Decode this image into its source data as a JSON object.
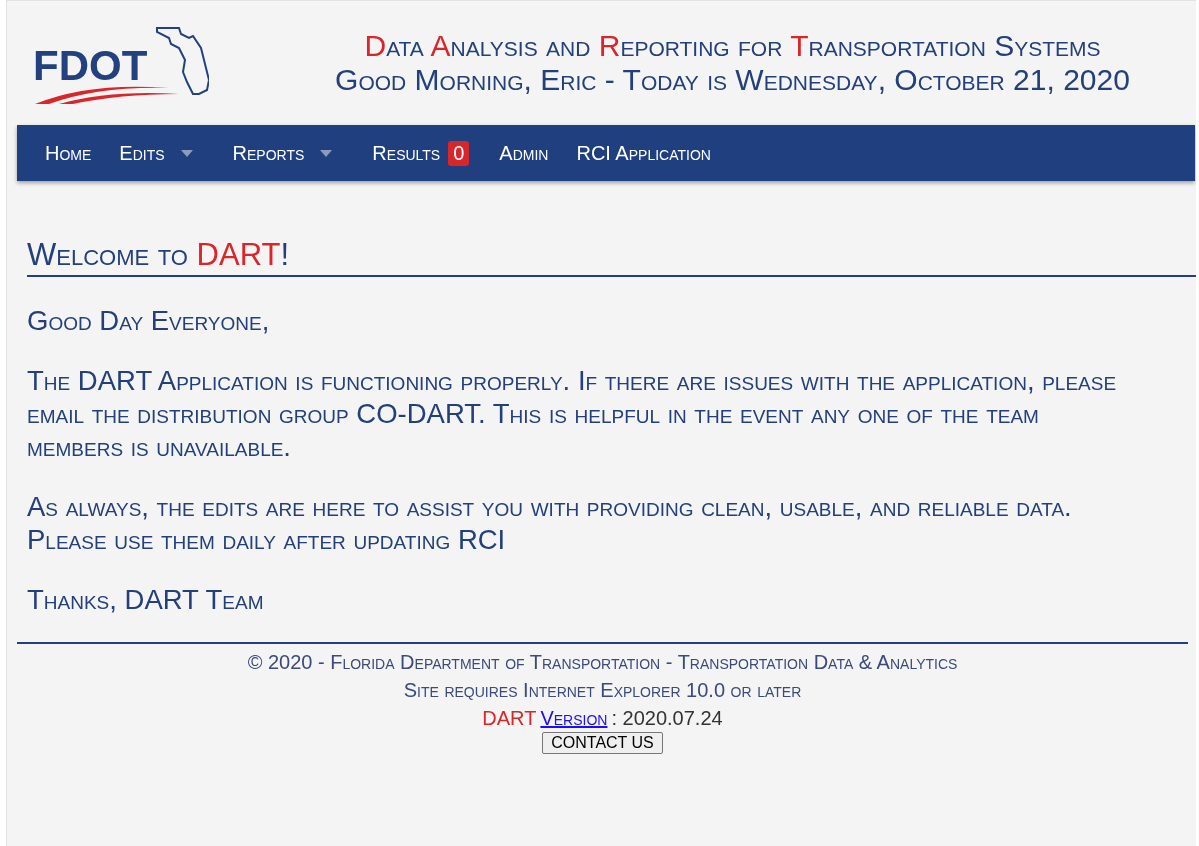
{
  "header": {
    "logo_text": "FDOT",
    "title": "**D**ata **A**nalysis and **R**eporting for **T**ransportation Systems",
    "greeting": "Good Morning, Eric - Today is Wednesday, October 21, 2020"
  },
  "nav": [
    {
      "label": "Home",
      "dropdown": false
    },
    {
      "label": "Edits",
      "dropdown": true
    },
    {
      "label": "Reports",
      "dropdown": true
    },
    {
      "label": "Results",
      "dropdown": false,
      "badge": "0"
    },
    {
      "label": "Admin",
      "dropdown": false
    },
    {
      "label": "RCI Application",
      "dropdown": false
    }
  ],
  "welcome": {
    "heading": "Welcome to **DART**!",
    "paragraphs": [
      "Good Day Everyone,",
      "The DART Application is functioning properly. If there are issues with the application, please email the distribution group CO-DART. This is helpful in the event any one of the team members is unavailable.",
      "As always, the edits are here to assist you with providing clean, usable, and reliable data. Please use them daily after updating RCI",
      "Thanks, DART Team"
    ]
  },
  "footer": {
    "copyright": "© 2020 - Florida Department of Transportation - Transportation Data & Analytics",
    "requirement": "Site requires Internet Explorer 10.0 or later",
    "brand": "DART",
    "version_link": "Version",
    "version": ": 2020.07.24",
    "contact_button": "CONTACT US"
  }
}
